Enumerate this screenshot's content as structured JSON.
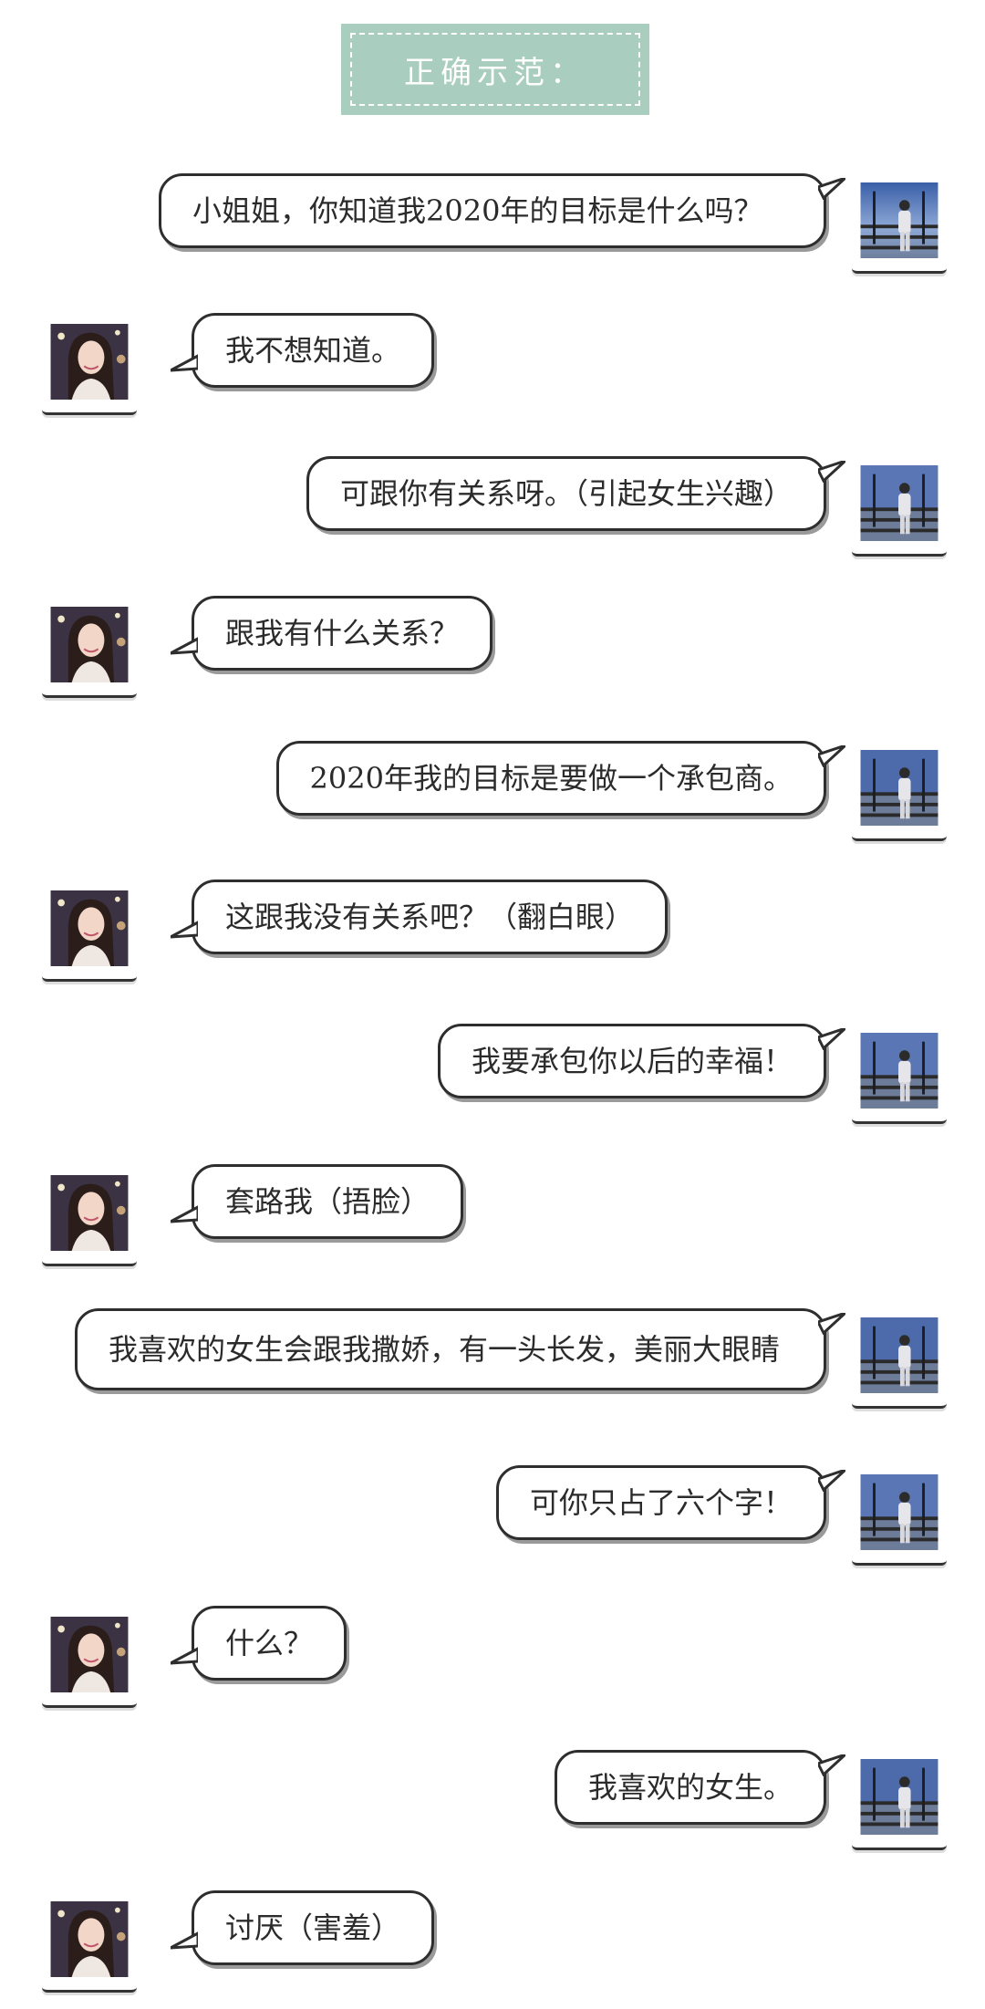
{
  "header": {
    "title": "正确示范："
  },
  "messages": [
    {
      "side": "right",
      "text": "小姐姐，你知道我2020年的目标是什么吗？"
    },
    {
      "side": "left",
      "text": "我不想知道。"
    },
    {
      "side": "right",
      "text": "可跟你有关系呀。（引起女生兴趣）"
    },
    {
      "side": "left",
      "text": "跟我有什么关系？"
    },
    {
      "side": "right",
      "text": "2020年我的目标是要做一个承包商。"
    },
    {
      "side": "left",
      "text": "这跟我没有关系吧？（翻白眼）"
    },
    {
      "side": "right",
      "text": "我要承包你以后的幸福！"
    },
    {
      "side": "left",
      "text": "套路我（捂脸）"
    },
    {
      "side": "right",
      "text": "我喜欢的女生会跟我撒娇，有一头长发，美丽大眼睛"
    },
    {
      "side": "right",
      "text": "可你只占了六个字！"
    },
    {
      "side": "left",
      "text": "什么？"
    },
    {
      "side": "right",
      "text": "我喜欢的女生。"
    },
    {
      "side": "left",
      "text": "讨厌（害羞）"
    }
  ],
  "avatars": {
    "right": {
      "icon": "male-avatar-photo"
    },
    "left": {
      "icon": "female-avatar-photo"
    }
  },
  "colors": {
    "header_bg": "#a9cdbf",
    "bubble_border": "#2e2e2e",
    "bubble_shadow": "#9a9a9a"
  }
}
